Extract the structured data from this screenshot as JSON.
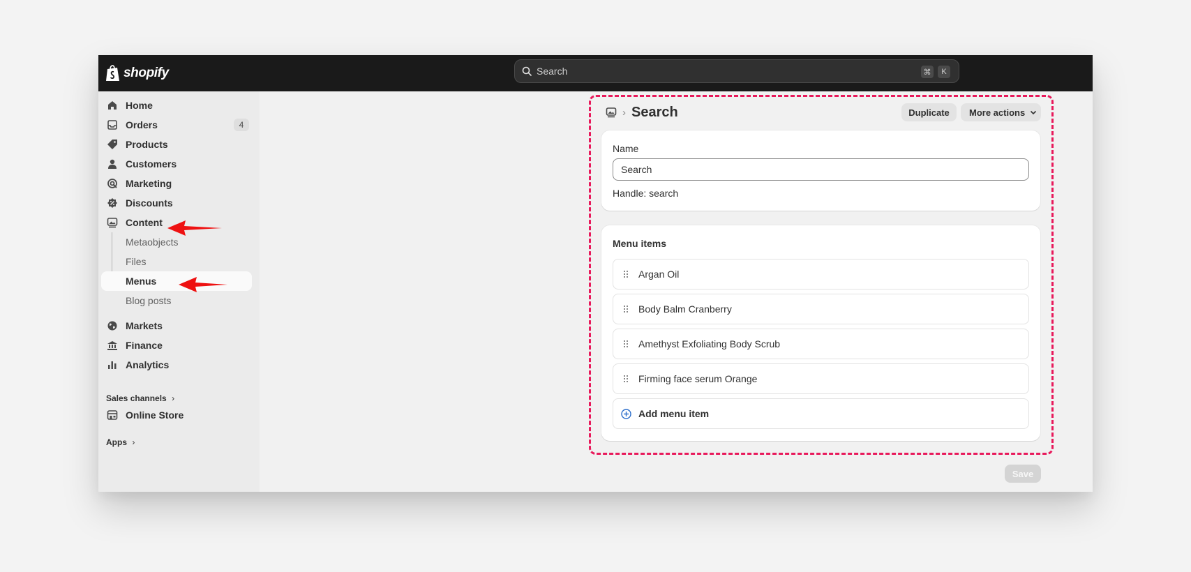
{
  "app": {
    "logo_text": "shopify"
  },
  "search": {
    "placeholder": "Search",
    "kbd1": "⌘",
    "kbd2": "K"
  },
  "sidebar": {
    "items": [
      {
        "label": "Home"
      },
      {
        "label": "Orders",
        "badge": "4"
      },
      {
        "label": "Products"
      },
      {
        "label": "Customers"
      },
      {
        "label": "Marketing"
      },
      {
        "label": "Discounts"
      },
      {
        "label": "Content"
      },
      {
        "label": "Metaobjects"
      },
      {
        "label": "Files"
      },
      {
        "label": "Menus"
      },
      {
        "label": "Blog posts"
      },
      {
        "label": "Markets"
      },
      {
        "label": "Finance"
      },
      {
        "label": "Analytics"
      },
      {
        "label": "Online Store"
      }
    ],
    "sales_channels": "Sales channels",
    "apps": "Apps"
  },
  "page": {
    "title": "Search",
    "duplicate_label": "Duplicate",
    "more_actions_label": "More actions",
    "name_label": "Name",
    "name_value": "Search",
    "handle_text": "Handle: search",
    "menu_items_title": "Menu items",
    "menu_items": [
      "Argan Oil",
      "Body Balm Cranberry",
      "Amethyst Exfoliating Body Scrub",
      "Firming face serum Orange"
    ],
    "add_menu_item": "Add menu item",
    "save_label": "Save"
  },
  "colors": {
    "annotation": "#e8195b",
    "arrow": "#ee1111",
    "topbar": "#1a1a1a",
    "add_icon": "#2c6ecb"
  }
}
